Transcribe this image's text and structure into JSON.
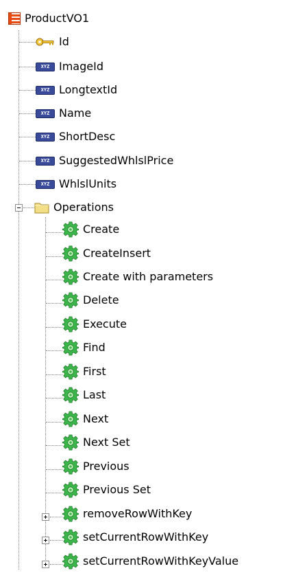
{
  "tree": {
    "root": {
      "label": "ProductVO1",
      "icon": "view-object-icon"
    },
    "attributes": [
      {
        "label": "Id",
        "icon": "key-icon"
      },
      {
        "label": "ImageId",
        "icon": "xyz-attribute-icon",
        "badge": "XYZ"
      },
      {
        "label": "LongtextId",
        "icon": "xyz-attribute-icon",
        "badge": "XYZ"
      },
      {
        "label": "Name",
        "icon": "xyz-attribute-icon",
        "badge": "XYZ"
      },
      {
        "label": "ShortDesc",
        "icon": "xyz-attribute-icon",
        "badge": "XYZ"
      },
      {
        "label": "SuggestedWhlslPrice",
        "icon": "xyz-attribute-icon",
        "badge": "XYZ"
      },
      {
        "label": "WhlslUnits",
        "icon": "xyz-attribute-icon",
        "badge": "XYZ"
      }
    ],
    "operations_folder": {
      "label": "Operations",
      "icon": "folder-icon",
      "expanded": true
    },
    "operations": [
      {
        "label": "Create",
        "icon": "gear-icon"
      },
      {
        "label": "CreateInsert",
        "icon": "gear-icon"
      },
      {
        "label": "Create with parameters",
        "icon": "gear-icon"
      },
      {
        "label": "Delete",
        "icon": "gear-icon"
      },
      {
        "label": "Execute",
        "icon": "gear-icon"
      },
      {
        "label": "Find",
        "icon": "gear-icon"
      },
      {
        "label": "First",
        "icon": "gear-icon"
      },
      {
        "label": "Last",
        "icon": "gear-icon"
      },
      {
        "label": "Next",
        "icon": "gear-icon"
      },
      {
        "label": "Next Set",
        "icon": "gear-icon"
      },
      {
        "label": "Previous",
        "icon": "gear-icon"
      },
      {
        "label": "Previous Set",
        "icon": "gear-icon"
      },
      {
        "label": "removeRowWithKey",
        "icon": "gear-icon",
        "expandable": true
      },
      {
        "label": "setCurrentRowWithKey",
        "icon": "gear-icon",
        "expandable": true
      },
      {
        "label": "setCurrentRowWithKeyValue",
        "icon": "gear-icon",
        "expandable": true
      }
    ],
    "colors": {
      "tree_line": "#808080",
      "gear": "#3cb54a",
      "xyz_badge": "#3a4a9a",
      "folder": "#f2de84",
      "root_icon": "#e84a10",
      "key": "#d8a410"
    }
  }
}
